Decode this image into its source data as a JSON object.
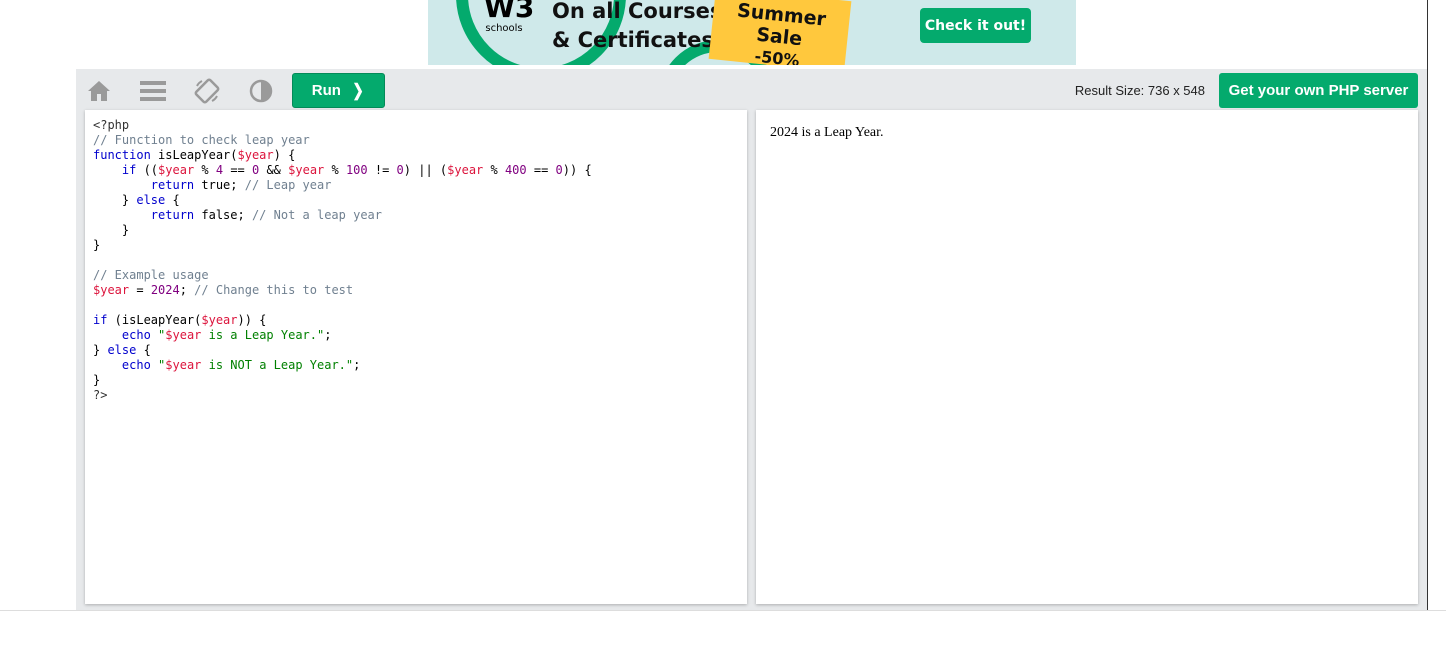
{
  "ad": {
    "logo_mark": "W3",
    "logo_text": "schools",
    "headline_1": "On all Courses",
    "headline_2": "& Certificates",
    "sale_1": "Summer Sale",
    "sale_2": "-50%",
    "cta": "Check it out!"
  },
  "colors": {
    "accent": "#04aa6d",
    "toolbar_bg": "#e7e9eb",
    "sale_yellow": "#ffc83d"
  },
  "toolbar": {
    "icons": [
      "home-icon",
      "menu-icon",
      "rotate-icon",
      "contrast-icon"
    ],
    "run_label": "Run",
    "run_chevron": "❯",
    "result_size": "Result Size: 736 x 548",
    "server_label": "Get your own PHP server"
  },
  "code_lines": [
    [
      {
        "t": "<?php",
        "c": "tag"
      }
    ],
    [
      {
        "t": "// Function to check leap year",
        "c": "com"
      }
    ],
    [
      {
        "t": "function",
        "c": "kw"
      },
      {
        "t": " isLeapYear(",
        "c": ""
      },
      {
        "t": "$year",
        "c": "var"
      },
      {
        "t": ") {",
        "c": ""
      }
    ],
    [
      {
        "t": "    ",
        "c": ""
      },
      {
        "t": "if",
        "c": "kw"
      },
      {
        "t": " ((",
        "c": ""
      },
      {
        "t": "$year",
        "c": "var"
      },
      {
        "t": " % ",
        "c": ""
      },
      {
        "t": "4",
        "c": "num"
      },
      {
        "t": " == ",
        "c": ""
      },
      {
        "t": "0",
        "c": "num"
      },
      {
        "t": " && ",
        "c": ""
      },
      {
        "t": "$year",
        "c": "var"
      },
      {
        "t": " % ",
        "c": ""
      },
      {
        "t": "100",
        "c": "num"
      },
      {
        "t": " != ",
        "c": ""
      },
      {
        "t": "0",
        "c": "num"
      },
      {
        "t": ") || (",
        "c": ""
      },
      {
        "t": "$year",
        "c": "var"
      },
      {
        "t": " % ",
        "c": ""
      },
      {
        "t": "400",
        "c": "num"
      },
      {
        "t": " == ",
        "c": ""
      },
      {
        "t": "0",
        "c": "num"
      },
      {
        "t": ")) {",
        "c": ""
      }
    ],
    [
      {
        "t": "        ",
        "c": ""
      },
      {
        "t": "return",
        "c": "kw"
      },
      {
        "t": " true; ",
        "c": ""
      },
      {
        "t": "// Leap year",
        "c": "com"
      }
    ],
    [
      {
        "t": "    } ",
        "c": ""
      },
      {
        "t": "else",
        "c": "kw"
      },
      {
        "t": " {",
        "c": ""
      }
    ],
    [
      {
        "t": "        ",
        "c": ""
      },
      {
        "t": "return",
        "c": "kw"
      },
      {
        "t": " false; ",
        "c": ""
      },
      {
        "t": "// Not a leap year",
        "c": "com"
      }
    ],
    [
      {
        "t": "    }",
        "c": ""
      }
    ],
    [
      {
        "t": "}",
        "c": ""
      }
    ],
    [],
    [
      {
        "t": "// Example usage",
        "c": "com"
      }
    ],
    [
      {
        "t": "$year",
        "c": "var"
      },
      {
        "t": " = ",
        "c": ""
      },
      {
        "t": "2024",
        "c": "num"
      },
      {
        "t": "; ",
        "c": ""
      },
      {
        "t": "// Change this to test",
        "c": "com"
      }
    ],
    [],
    [
      {
        "t": "if",
        "c": "kw"
      },
      {
        "t": " (isLeapYear(",
        "c": ""
      },
      {
        "t": "$year",
        "c": "var"
      },
      {
        "t": ")) {",
        "c": ""
      }
    ],
    [
      {
        "t": "    ",
        "c": ""
      },
      {
        "t": "echo",
        "c": "kw"
      },
      {
        "t": " ",
        "c": ""
      },
      {
        "t": "\"",
        "c": "str"
      },
      {
        "t": "$year",
        "c": "var"
      },
      {
        "t": " is a Leap Year.\"",
        "c": "str"
      },
      {
        "t": ";",
        "c": ""
      }
    ],
    [
      {
        "t": "} ",
        "c": ""
      },
      {
        "t": "else",
        "c": "kw"
      },
      {
        "t": " {",
        "c": ""
      }
    ],
    [
      {
        "t": "    ",
        "c": ""
      },
      {
        "t": "echo",
        "c": "kw"
      },
      {
        "t": " ",
        "c": ""
      },
      {
        "t": "\"",
        "c": "str"
      },
      {
        "t": "$year",
        "c": "var"
      },
      {
        "t": " is NOT a Leap Year.\"",
        "c": "str"
      },
      {
        "t": ";",
        "c": ""
      }
    ],
    [
      {
        "t": "}",
        "c": ""
      }
    ],
    [
      {
        "t": "?>",
        "c": "tag"
      }
    ]
  ],
  "result": {
    "text": "2024 is a Leap Year."
  }
}
